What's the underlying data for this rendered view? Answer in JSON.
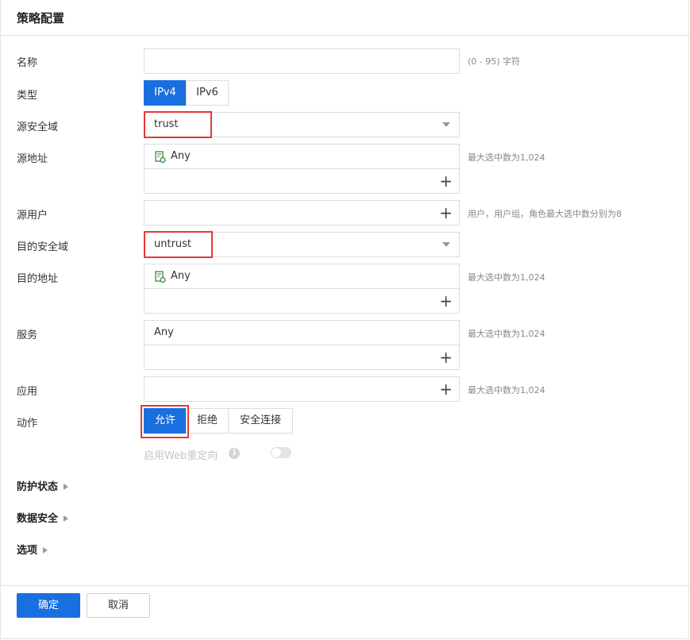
{
  "header": {
    "title": "策略配置"
  },
  "form": {
    "name": {
      "label": "名称",
      "value": "",
      "hint": "(0 - 95) 字符"
    },
    "type": {
      "label": "类型",
      "options": [
        "IPv4",
        "IPv6"
      ],
      "selected": "IPv4"
    },
    "src_zone": {
      "label": "源安全域",
      "value": "trust"
    },
    "src_addr": {
      "label": "源地址",
      "items": [
        "Any"
      ],
      "hint": "最大选中数为1,024"
    },
    "src_user": {
      "label": "源用户",
      "hint": "用户，用户组，角色最大选中数分别为8"
    },
    "dst_zone": {
      "label": "目的安全域",
      "value": "untrust"
    },
    "dst_addr": {
      "label": "目的地址",
      "items": [
        "Any"
      ],
      "hint": "最大选中数为1,024"
    },
    "service": {
      "label": "服务",
      "items": [
        "Any"
      ],
      "hint": "最大选中数为1,024"
    },
    "app": {
      "label": "应用",
      "hint": "最大选中数为1,024"
    },
    "action": {
      "label": "动作",
      "options": [
        "允许",
        "拒绝",
        "安全连接"
      ],
      "selected": "允许"
    },
    "web_redirect": {
      "label": "启用Web重定向",
      "info": "i",
      "enabled": false
    }
  },
  "sections": {
    "protection": "防护状态",
    "data_security": "数据安全",
    "options": "选项"
  },
  "footer": {
    "confirm": "确定",
    "cancel": "取消"
  },
  "colors": {
    "primary": "#1a6fdf",
    "highlight": "#e53935",
    "border": "#dcdcdc"
  }
}
